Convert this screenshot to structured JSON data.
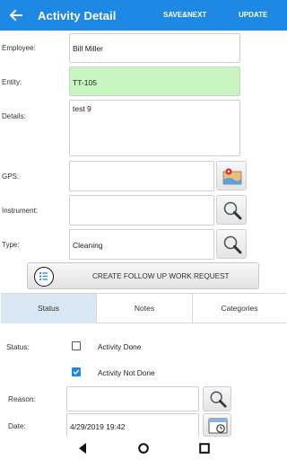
{
  "app_bar": {
    "title": "Activity Detail",
    "save_next": "SAVE&NEXT",
    "update": "UPDATE",
    "color": "#1e88e5"
  },
  "form": {
    "employee": {
      "label": "Employee:",
      "value": "Bill Miller"
    },
    "entity": {
      "label": "Entity:",
      "value": "TT-105",
      "bg": "#c8f5c0"
    },
    "details": {
      "label": "Details:",
      "value": "test 9"
    },
    "gps": {
      "label": "GPS:",
      "value": "",
      "icon": "map-icon"
    },
    "instrument": {
      "label": "Instrument:",
      "value": "",
      "icon": "search-icon"
    },
    "type": {
      "label": "Type:",
      "value": "Cleaning",
      "icon": "search-icon"
    }
  },
  "followup": {
    "label": "CREATE FOLLOW UP WORK REQUEST",
    "icon": "list-icon"
  },
  "tabs": [
    {
      "label": "Status",
      "active": true
    },
    {
      "label": "Notes",
      "active": false
    },
    {
      "label": "Categories",
      "active": false
    }
  ],
  "status": {
    "label": "Status:",
    "options": [
      {
        "label": "Activity Done",
        "checked": false
      },
      {
        "label": "Activity Not Done",
        "checked": true
      }
    ]
  },
  "reason": {
    "label": "Reason:",
    "value": ""
  },
  "date": {
    "label": "Date:",
    "value": "4/29/2019 19:42",
    "icon": "calendar-icon"
  }
}
